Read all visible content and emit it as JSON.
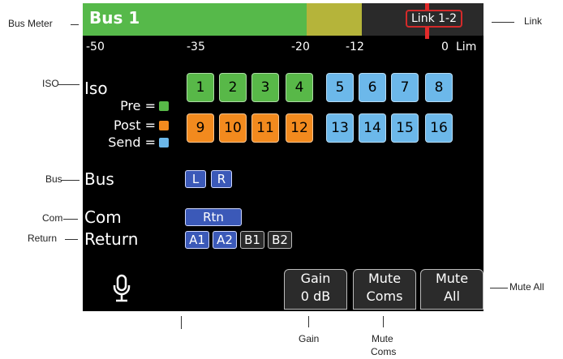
{
  "callouts": {
    "bus_meter": "Bus Meter",
    "link": "Link",
    "iso": "ISO",
    "bus": "Bus",
    "com": "Com",
    "return": "Return",
    "mute_all": "Mute All",
    "gain": "Gain",
    "mute_coms_line1": "Mute",
    "mute_coms_line2": "Coms"
  },
  "meter": {
    "title": "Bus 1",
    "link_label": "Link 1-2",
    "scale": [
      "-50",
      "-35",
      "-20",
      "-12",
      "0",
      "Lim"
    ],
    "colors": {
      "green": "#56b94a",
      "yellow": "#b5b43a",
      "peak": "#e22a2a"
    }
  },
  "iso": {
    "label": "Iso",
    "pre_label": "Pre =",
    "post_label": "Post =",
    "send_label": "Send =",
    "row1": [
      "1",
      "2",
      "3",
      "4",
      "5",
      "6",
      "7",
      "8"
    ],
    "row2": [
      "9",
      "10",
      "11",
      "12",
      "13",
      "14",
      "15",
      "16"
    ],
    "colors": {
      "pre": "#58b848",
      "post": "#f28a1e",
      "send": "#6cb8ea"
    }
  },
  "bus": {
    "label": "Bus",
    "left": "L",
    "right": "R"
  },
  "com": {
    "label": "Com",
    "rtn": "Rtn"
  },
  "return_row": {
    "label": "Return",
    "a1": "A1",
    "a2": "A2",
    "b1": "B1",
    "b2": "B2"
  },
  "softkeys": {
    "gain_top": "Gain",
    "gain_bottom": "0 dB",
    "mute_coms_top": "Mute",
    "mute_coms_bottom": "Coms",
    "mute_all_top": "Mute",
    "mute_all_bottom": "All"
  },
  "icons": {
    "mic": "microphone-icon"
  }
}
